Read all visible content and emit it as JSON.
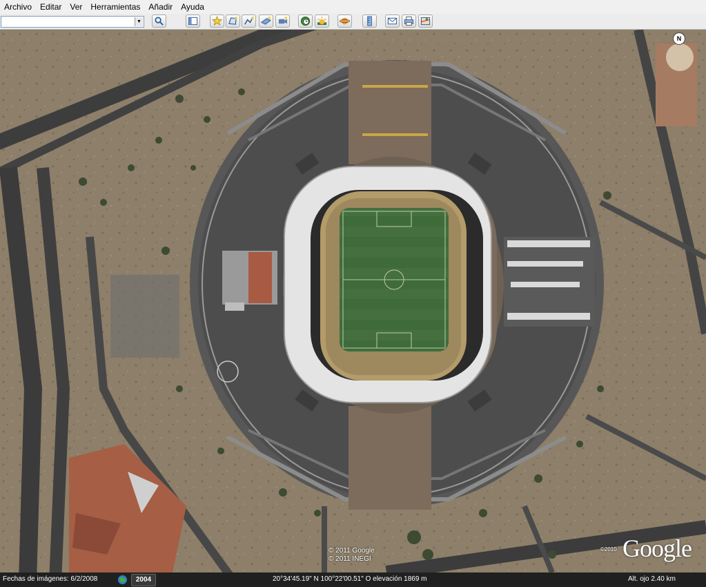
{
  "menu": {
    "items": [
      "Archivo",
      "Editar",
      "Ver",
      "Herramientas",
      "Añadir",
      "Ayuda"
    ]
  },
  "toolbar": {
    "search_value": "",
    "buttons": [
      {
        "name": "search-button",
        "icon": "search-icon"
      },
      {
        "name": "sidebar-toggle-button",
        "icon": "sidebar-icon"
      },
      {
        "name": "add-placemark-button",
        "icon": "pushpin-icon"
      },
      {
        "name": "add-polygon-button",
        "icon": "polygon-icon"
      },
      {
        "name": "add-path-button",
        "icon": "path-icon"
      },
      {
        "name": "image-overlay-button",
        "icon": "overlay-icon"
      },
      {
        "name": "record-tour-button",
        "icon": "record-icon"
      },
      {
        "name": "historical-imagery-button",
        "icon": "clock-globe-icon"
      },
      {
        "name": "sunlight-button",
        "icon": "sun-icon"
      },
      {
        "name": "switch-to-sky-button",
        "icon": "planet-icon"
      },
      {
        "name": "ruler-button",
        "icon": "ruler-icon"
      },
      {
        "name": "email-button",
        "icon": "mail-icon"
      },
      {
        "name": "print-button",
        "icon": "printer-icon"
      },
      {
        "name": "view-in-maps-button",
        "icon": "map-icon"
      }
    ]
  },
  "map": {
    "compass_label": "N",
    "copyright_line1": "© 2011 Google",
    "copyright_line2": "© 2011 INEGI",
    "watermark_year": "©2010",
    "watermark_brand": "Google"
  },
  "status": {
    "imagery_date": "Fechas de imágenes: 6/2/2008",
    "year": "2004",
    "coordinates": "20°34'45.19\" N 100°22'00.51\" O elevación 1869 m",
    "eye_alt": "Alt. ojo    2.40 km"
  },
  "colors": {
    "menubar_bg": "#f0f0f0",
    "statusbar_bg": "#202020",
    "pitch_green": "#3f6b3a",
    "asphalt": "#4f4f4f",
    "dry_land": "#8b7d68"
  }
}
